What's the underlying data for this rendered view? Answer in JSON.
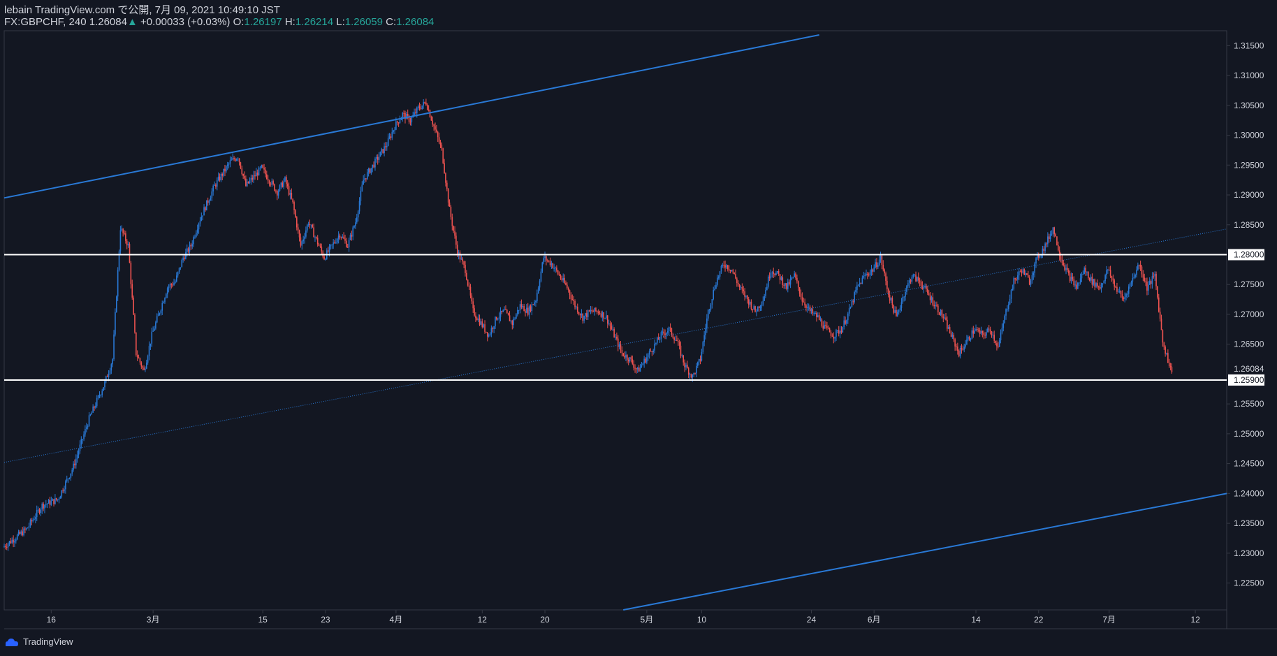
{
  "header": {
    "line1": "lebain TradingView.com で公開, 7月 09, 2021 10:49:10 JST",
    "symbol": "FX:GBPCHF, 240",
    "last": "1.26084",
    "arrow": "▲",
    "change": "+0.00033 (+0.03%)",
    "o_label": "O:",
    "o": "1.26197",
    "h_label": "H:",
    "h": "1.26214",
    "l_label": "L:",
    "l": "1.26059",
    "c_label": "C:",
    "c": "1.26084"
  },
  "footer": {
    "brand": "TradingView"
  },
  "colors": {
    "background": "#131722",
    "up": "#2979d6",
    "down": "#ef5350",
    "trendline": "#2979d6",
    "level": "#ffffff",
    "axis_text": "#d1d4dc"
  },
  "chart_data": {
    "type": "candlestick",
    "ylim": [
      1.2205,
      1.3175
    ],
    "price_ticks": [
      "1.31500",
      "1.31000",
      "1.30500",
      "1.30000",
      "1.29500",
      "1.29000",
      "1.28500",
      "1.28000",
      "1.27500",
      "1.27000",
      "1.26500",
      "1.26084",
      "1.25900",
      "1.25500",
      "1.25000",
      "1.24500",
      "1.24000",
      "1.23500",
      "1.23000",
      "1.22500"
    ],
    "date_ticks": [
      "16",
      "3月",
      "15",
      "23",
      "4月",
      "12",
      "20",
      "5月",
      "10",
      "24",
      "6月",
      "14",
      "22",
      "7月",
      "12"
    ],
    "horizontal_levels": [
      {
        "price": 1.28,
        "label": "1.28000"
      },
      {
        "price": 1.259,
        "label": "1.25900"
      }
    ],
    "current_price": {
      "price": 1.26084,
      "label": "1.26084"
    },
    "channel_lines": [
      {
        "style": "solid",
        "from": [
          "2021-02-10",
          1.2895
        ],
        "to": [
          "2021-05-25",
          1.3168
        ]
      },
      {
        "style": "solid",
        "from": [
          "2021-04-30",
          1.2205
        ],
        "to": [
          "2021-07-16",
          1.24
        ]
      },
      {
        "style": "dotted",
        "from": [
          "2021-02-10",
          1.2452
        ],
        "to": [
          "2021-07-16",
          1.2843
        ]
      }
    ],
    "price_path": [
      [
        "2021-02-10",
        1.231
      ],
      [
        "2021-02-13",
        1.234
      ],
      [
        "2021-02-15",
        1.238
      ],
      [
        "2021-02-17",
        1.239
      ],
      [
        "2021-02-19",
        1.2445
      ],
      [
        "2021-02-21",
        1.2525
      ],
      [
        "2021-02-23",
        1.2585
      ],
      [
        "2021-02-24",
        1.2625
      ],
      [
        "2021-02-25",
        1.2845
      ],
      [
        "2021-02-26",
        1.2815
      ],
      [
        "2021-02-27",
        1.2635
      ],
      [
        "2021-02-28",
        1.2605
      ],
      [
        "2021-03-01",
        1.2665
      ],
      [
        "2021-03-03",
        1.2745
      ],
      [
        "2021-03-04",
        1.2755
      ],
      [
        "2021-03-05",
        1.2795
      ],
      [
        "2021-03-06",
        1.2815
      ],
      [
        "2021-03-07",
        1.2855
      ],
      [
        "2021-03-09",
        1.2915
      ],
      [
        "2021-03-11",
        1.2955
      ],
      [
        "2021-03-12",
        1.2965
      ],
      [
        "2021-03-13",
        1.2915
      ],
      [
        "2021-03-15",
        1.2945
      ],
      [
        "2021-03-17",
        1.2905
      ],
      [
        "2021-03-18",
        1.2925
      ],
      [
        "2021-03-19",
        1.2885
      ],
      [
        "2021-03-20",
        1.2815
      ],
      [
        "2021-03-21",
        1.2855
      ],
      [
        "2021-03-22",
        1.2825
      ],
      [
        "2021-03-23",
        1.2795
      ],
      [
        "2021-03-25",
        1.2835
      ],
      [
        "2021-03-26",
        1.2815
      ],
      [
        "2021-03-27",
        1.2855
      ],
      [
        "2021-03-28",
        1.2925
      ],
      [
        "2021-03-29",
        1.2945
      ],
      [
        "2021-03-30",
        1.2965
      ],
      [
        "2021-03-31",
        1.2985
      ],
      [
        "2021-04-01",
        1.3015
      ],
      [
        "2021-04-02",
        1.3035
      ],
      [
        "2021-04-03",
        1.3025
      ],
      [
        "2021-04-04",
        1.3045
      ],
      [
        "2021-04-05",
        1.3055
      ],
      [
        "2021-04-06",
        1.3015
      ],
      [
        "2021-04-07",
        1.2975
      ],
      [
        "2021-04-08",
        1.2875
      ],
      [
        "2021-04-09",
        1.2805
      ],
      [
        "2021-04-10",
        1.2775
      ],
      [
        "2021-04-11",
        1.2705
      ],
      [
        "2021-04-12",
        1.2685
      ],
      [
        "2021-04-13",
        1.2665
      ],
      [
        "2021-04-14",
        1.2695
      ],
      [
        "2021-04-15",
        1.2705
      ],
      [
        "2021-04-16",
        1.2685
      ],
      [
        "2021-04-17",
        1.2715
      ],
      [
        "2021-04-18",
        1.2705
      ],
      [
        "2021-04-19",
        1.2725
      ],
      [
        "2021-04-20",
        1.2795
      ],
      [
        "2021-04-21",
        1.2785
      ],
      [
        "2021-04-22",
        1.2765
      ],
      [
        "2021-04-23",
        1.2745
      ],
      [
        "2021-04-24",
        1.2715
      ],
      [
        "2021-04-25",
        1.2695
      ],
      [
        "2021-04-26",
        1.2705
      ],
      [
        "2021-04-27",
        1.2705
      ],
      [
        "2021-04-28",
        1.2695
      ],
      [
        "2021-04-29",
        1.2665
      ],
      [
        "2021-04-30",
        1.2635
      ],
      [
        "2021-05-01",
        1.2625
      ],
      [
        "2021-05-02",
        1.2605
      ],
      [
        "2021-05-03",
        1.2625
      ],
      [
        "2021-05-04",
        1.2645
      ],
      [
        "2021-05-05",
        1.2665
      ],
      [
        "2021-05-06",
        1.2675
      ],
      [
        "2021-05-07",
        1.2655
      ],
      [
        "2021-05-08",
        1.2615
      ],
      [
        "2021-05-09",
        1.2595
      ],
      [
        "2021-05-10",
        1.2625
      ],
      [
        "2021-05-11",
        1.2705
      ],
      [
        "2021-05-12",
        1.2755
      ],
      [
        "2021-05-13",
        1.2785
      ],
      [
        "2021-05-14",
        1.2775
      ],
      [
        "2021-05-15",
        1.2745
      ],
      [
        "2021-05-16",
        1.2725
      ],
      [
        "2021-05-17",
        1.2705
      ],
      [
        "2021-05-18",
        1.2725
      ],
      [
        "2021-05-19",
        1.2775
      ],
      [
        "2021-05-20",
        1.2765
      ],
      [
        "2021-05-21",
        1.2745
      ],
      [
        "2021-05-22",
        1.2765
      ],
      [
        "2021-05-23",
        1.2725
      ],
      [
        "2021-05-24",
        1.2705
      ],
      [
        "2021-05-25",
        1.2695
      ],
      [
        "2021-05-26",
        1.2675
      ],
      [
        "2021-05-27",
        1.2665
      ],
      [
        "2021-05-28",
        1.2675
      ],
      [
        "2021-05-29",
        1.2705
      ],
      [
        "2021-05-30",
        1.2745
      ],
      [
        "2021-05-31",
        1.2765
      ],
      [
        "2021-06-01",
        1.2775
      ],
      [
        "2021-06-02",
        1.2795
      ],
      [
        "2021-06-03",
        1.2735
      ],
      [
        "2021-06-04",
        1.2695
      ],
      [
        "2021-06-05",
        1.2735
      ],
      [
        "2021-06-06",
        1.2765
      ],
      [
        "2021-06-07",
        1.2755
      ],
      [
        "2021-06-08",
        1.2735
      ],
      [
        "2021-06-09",
        1.2715
      ],
      [
        "2021-06-10",
        1.2695
      ],
      [
        "2021-06-11",
        1.2665
      ],
      [
        "2021-06-12",
        1.2635
      ],
      [
        "2021-06-13",
        1.2655
      ],
      [
        "2021-06-14",
        1.2675
      ],
      [
        "2021-06-15",
        1.2665
      ],
      [
        "2021-06-16",
        1.2675
      ],
      [
        "2021-06-17",
        1.2645
      ],
      [
        "2021-06-18",
        1.2705
      ],
      [
        "2021-06-19",
        1.2755
      ],
      [
        "2021-06-20",
        1.2775
      ],
      [
        "2021-06-21",
        1.2755
      ],
      [
        "2021-06-22",
        1.2795
      ],
      [
        "2021-06-23",
        1.2815
      ],
      [
        "2021-06-24",
        1.2845
      ],
      [
        "2021-06-25",
        1.2795
      ],
      [
        "2021-06-26",
        1.2765
      ],
      [
        "2021-06-27",
        1.2745
      ],
      [
        "2021-06-28",
        1.2775
      ],
      [
        "2021-06-29",
        1.2755
      ],
      [
        "2021-06-30",
        1.2745
      ],
      [
        "2021-07-01",
        1.2775
      ],
      [
        "2021-07-02",
        1.2745
      ],
      [
        "2021-07-03",
        1.2725
      ],
      [
        "2021-07-04",
        1.2755
      ],
      [
        "2021-07-05",
        1.2785
      ],
      [
        "2021-07-06",
        1.2745
      ],
      [
        "2021-07-07",
        1.2765
      ],
      [
        "2021-07-08",
        1.2655
      ],
      [
        "2021-07-09",
        1.2608
      ]
    ]
  }
}
